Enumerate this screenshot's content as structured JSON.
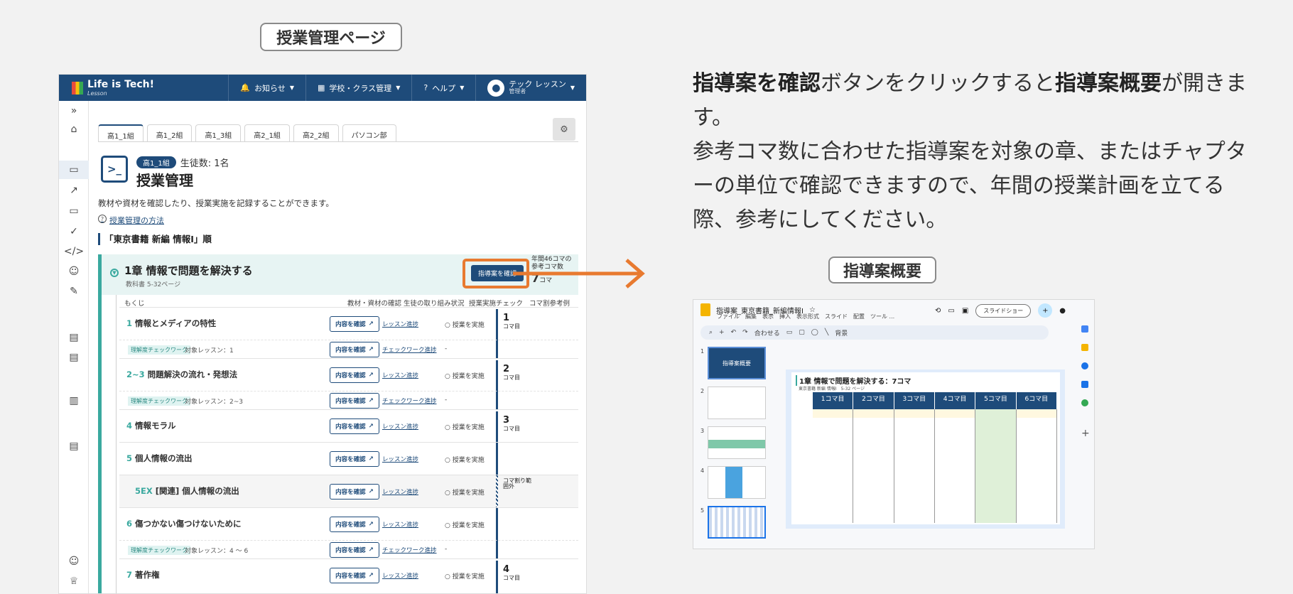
{
  "labels": {
    "page_label": "授業管理ページ",
    "overview_label": "指導案概要"
  },
  "description": {
    "p1_b1": "指導案を確認",
    "p1_t1": "ボタンをクリックすると",
    "p1_b2": "指導案概要",
    "p1_t2": "が開きます。",
    "p2": "参考コマ数に合わせた指導案を対象の章、またはチャプターの単位で確認できますので、年間の授業計画を立てる際、参考にしてください。"
  },
  "topbar": {
    "brand": "Life is Tech!",
    "brand_sub": "Lesson",
    "notice": "お知らせ",
    "school": "学校・クラス管理",
    "help": "ヘルプ",
    "user_name": "テック レッスン",
    "user_role": "管理者"
  },
  "tabs": [
    "高1_1組",
    "高1_2組",
    "高1_3組",
    "高2_1組",
    "高2_2組",
    "パソコン部"
  ],
  "header": {
    "class_badge": "高1_1組",
    "students": "生徒数: 1名",
    "title": "授業管理",
    "desc": "教材や資材を確認したり、授業実施を記録することができます。",
    "howto": "授業管理の方法",
    "textbook": "「東京書籍 新編 情報Ⅰ」順"
  },
  "chapter": {
    "title": "1章 情報で問題を解決する",
    "pages": "教科書 5-32ページ",
    "confirm": "指導案を確認",
    "koma_label": "年間46コマの参考コマ数",
    "koma_value": "7",
    "koma_unit": "コマ"
  },
  "columns": {
    "toc": "もくじ",
    "materials": "教材・資材の確認",
    "status": "生徒の取り組み状況",
    "check": "授業実施チェック",
    "koma": "コマ割参考例"
  },
  "common": {
    "btn": "内容を確認",
    "lesson_link": "レッスン進捗",
    "check_link": "チェックワーク進捗",
    "record": "授業を実施",
    "check_tag": "理解度チェックワーク",
    "dash": "-",
    "koma_suffix": "コマ目",
    "out": "コマ割り範囲外"
  },
  "rows": [
    {
      "num": "1",
      "name": "情報とメディアの特性",
      "koma": "1"
    },
    {
      "num": "2~3",
      "name": "問題解決の流れ・発想法",
      "koma": "2"
    },
    {
      "num": "4",
      "name": "情報モラル",
      "koma": "3"
    },
    {
      "num": "5",
      "name": "個人情報の流出",
      "koma": ""
    },
    {
      "num": "5EX",
      "name": "[関連] 個人情報の流出",
      "koma": ""
    },
    {
      "num": "6",
      "name": "傷つかない傷つけないために",
      "koma": ""
    },
    {
      "num": "7",
      "name": "著作権",
      "koma": "4"
    }
  ],
  "subs": [
    "対象レッスン：1",
    "対象レッスン：2~3",
    "対象レッスン：4 〜 6"
  ],
  "slides": {
    "file": "指導案_東京書籍_新編情報Ⅰ",
    "menu": "ファイル　編集　表示　挿入　表示形式　スライド　配置　ツール ...",
    "slideshow": "スライドショー",
    "toolbar": "背景",
    "zoom": "合わせる",
    "doc_title": "1章 情報で問題を解決する：7コマ",
    "doc_sub": "東京書籍 新編 情報Ⅰ　5-32 ページ",
    "thumb1": "指導案概要",
    "cols": [
      "1コマ目",
      "2コマ目",
      "3コマ目",
      "4コマ目",
      "5コマ目",
      "6コマ目"
    ],
    "thumb_nums": [
      "1",
      "2",
      "3",
      "4",
      "5"
    ]
  }
}
